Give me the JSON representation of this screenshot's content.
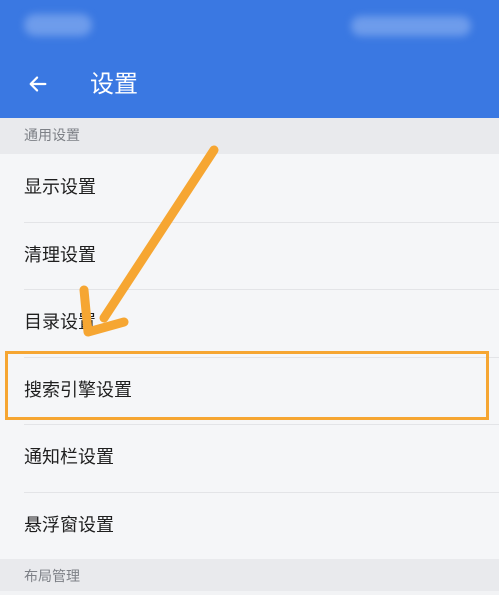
{
  "header": {
    "title": "设置"
  },
  "sections": [
    {
      "label": "通用设置"
    },
    {
      "label": "布局管理"
    }
  ],
  "settings_items": [
    {
      "label": "显示设置"
    },
    {
      "label": "清理设置"
    },
    {
      "label": "目录设置"
    },
    {
      "label": "搜索引擎设置"
    },
    {
      "label": "通知栏设置"
    },
    {
      "label": "悬浮窗设置"
    }
  ],
  "colors": {
    "app_bar": "#3a78e2",
    "highlight": "#f6a632",
    "arrow": "#f6a632"
  },
  "icons": {
    "back": "arrow-left-icon"
  }
}
